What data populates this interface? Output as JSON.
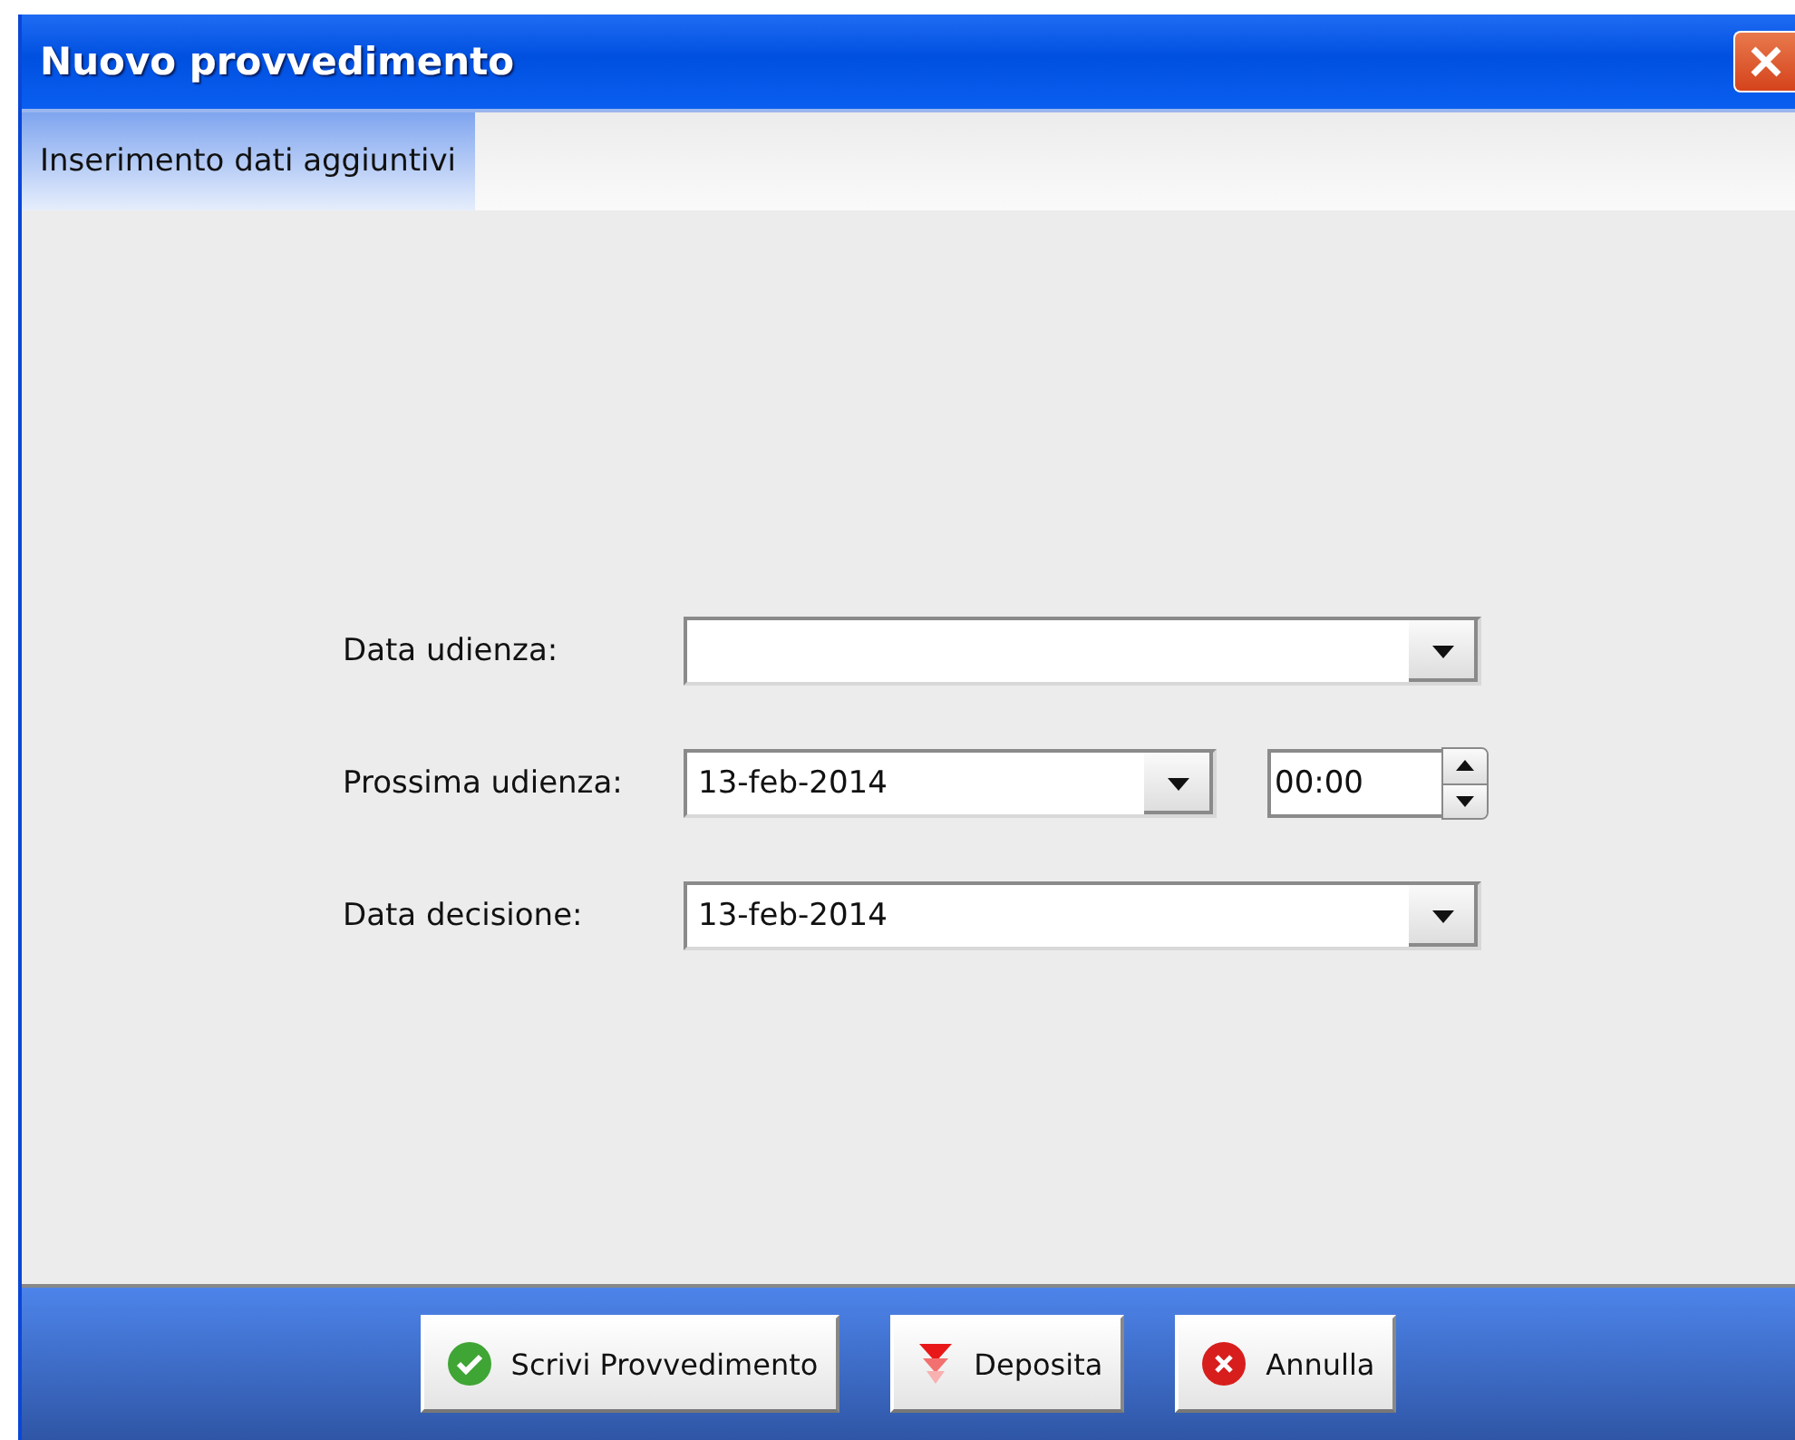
{
  "window": {
    "title": "Nuovo provvedimento"
  },
  "tabs": [
    {
      "label": "Inserimento dati aggiuntivi",
      "selected": true
    }
  ],
  "fields": [
    {
      "label": "Data udienza:",
      "kind": "date"
    },
    {
      "label": "Prossima udienza:",
      "value": "13-feb-2014",
      "kind": "datetime",
      "time": "00:00"
    },
    {
      "label": "Data decisione:",
      "value": "13-feb-2014",
      "kind": "date"
    }
  ],
  "buttons": [
    {
      "label": "Scrivi Provvedimento",
      "kind": "confirm"
    },
    {
      "label": "Deposita",
      "kind": "deposit"
    },
    {
      "label": "Annulla",
      "kind": "cancel"
    }
  ]
}
